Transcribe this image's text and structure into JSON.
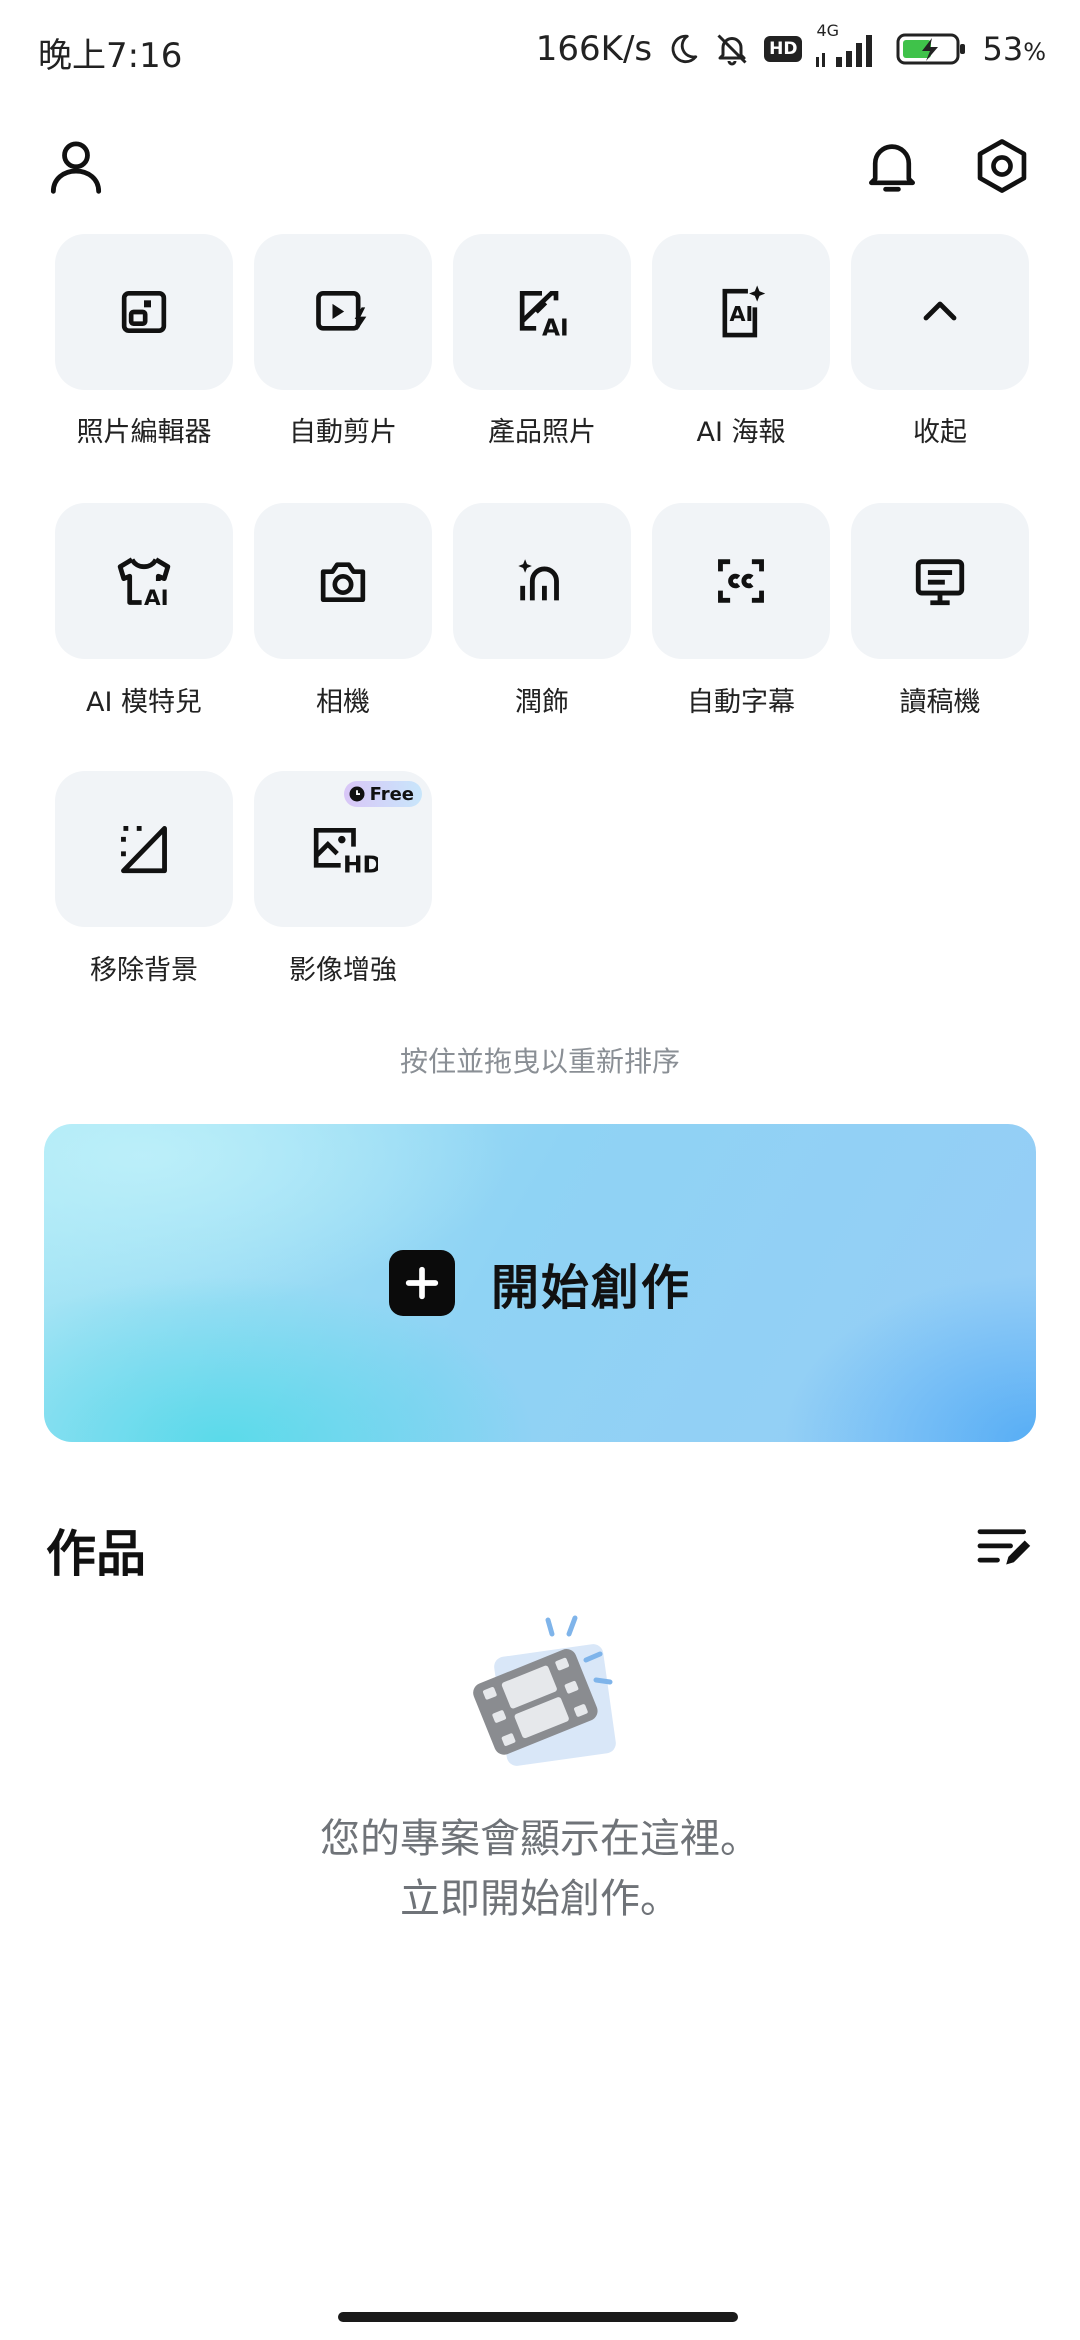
{
  "status_bar": {
    "time": "晚上7:16",
    "net_speed": "166K/s",
    "hd_badge": "HD",
    "network": "4G",
    "battery": "53",
    "battery_unit": "%"
  },
  "tools": [
    {
      "label": "照片編輯器",
      "icon": "photo-editor-icon"
    },
    {
      "label": "自動剪片",
      "icon": "auto-cut-icon"
    },
    {
      "label": "產品照片",
      "icon": "product-photo-icon"
    },
    {
      "label": "AI 海報",
      "icon": "ai-poster-icon"
    },
    {
      "label": "收起",
      "icon": "chevron-up-icon"
    },
    {
      "label": "AI 模特兒",
      "icon": "ai-model-icon"
    },
    {
      "label": "相機",
      "icon": "camera-icon"
    },
    {
      "label": "潤飾",
      "icon": "retouch-icon"
    },
    {
      "label": "自動字幕",
      "icon": "auto-captions-icon"
    },
    {
      "label": "讀稿機",
      "icon": "teleprompter-icon"
    },
    {
      "label": "移除背景",
      "icon": "remove-background-icon"
    },
    {
      "label": "影像增強",
      "icon": "enhance-hd-icon",
      "badge": "Free"
    }
  ],
  "hint": "按住並拖曳以重新排序",
  "create_button": {
    "label": "開始創作"
  },
  "works": {
    "title": "作品",
    "empty_line1": "您的專案會顯示在這裡。",
    "empty_line2": "立即開始創作。"
  }
}
